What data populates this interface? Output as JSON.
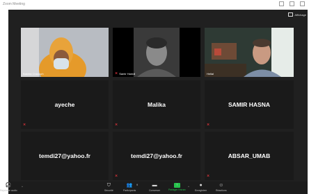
{
  "window": {
    "title": "Zoom Meeting"
  },
  "view_button": {
    "label": "Affichage"
  },
  "participants": [
    {
      "name": "Bakhta Chaouch",
      "muted": false
    },
    {
      "name": "Samir Hamdi",
      "muted": false
    },
    {
      "name": "Hellal",
      "muted": false
    },
    {
      "name": "ayeche",
      "muted": true
    },
    {
      "name": "Malika",
      "muted": true
    },
    {
      "name": "SAMIR HASNA",
      "muted": true
    },
    {
      "name": "temdi27@yahoo.fr",
      "muted": false
    },
    {
      "name": "temdi27@yahoo.fr",
      "muted": true
    },
    {
      "name": "ABSAR_UMAB",
      "muted": true
    }
  ],
  "toolbar": {
    "audio": "Rejoindre audio",
    "security": "Sécurité",
    "participants": "Participants",
    "participants_count": "9",
    "chat": "Converser",
    "share": "Partager l'écran",
    "record": "Enregistrer",
    "reactions": "Réactions"
  },
  "colors": {
    "active_speaker": "#b9e33d",
    "muted": "#e0343c",
    "share": "#27c24c"
  }
}
